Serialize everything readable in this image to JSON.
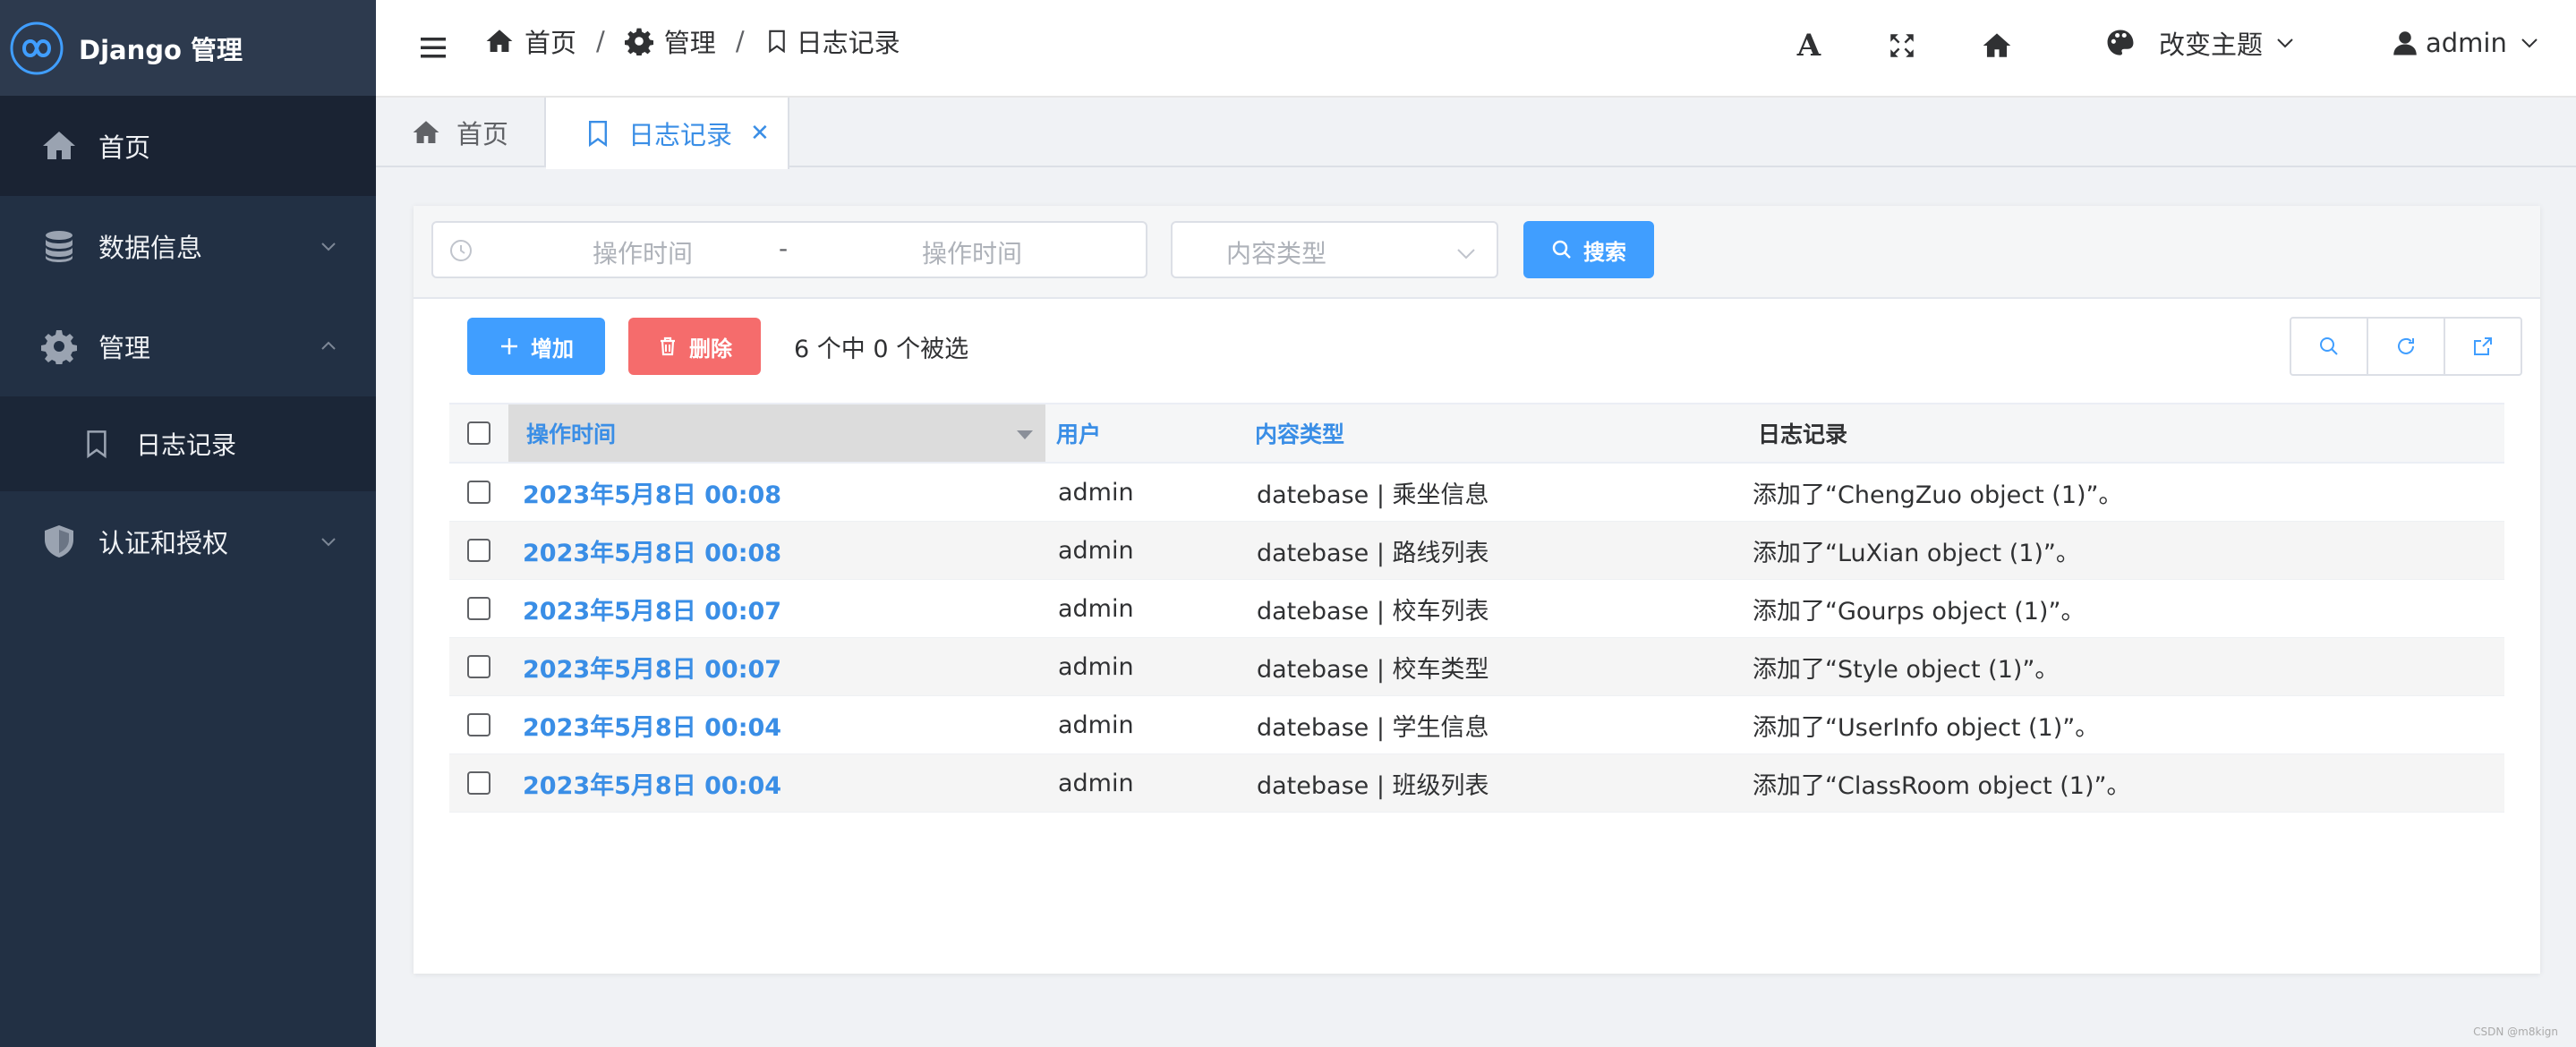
{
  "brand": {
    "title": "Django 管理"
  },
  "sidebar": {
    "items": [
      {
        "label": "首页",
        "icon": "home-icon"
      },
      {
        "label": "数据信息",
        "icon": "database-icon"
      },
      {
        "label": "管理",
        "icon": "gear-icon"
      },
      {
        "label": "日志记录",
        "icon": "bookmark-icon"
      },
      {
        "label": "认证和授权",
        "icon": "shield-icon"
      }
    ]
  },
  "header": {
    "breadcrumb": [
      "首页",
      "管理",
      "日志记录"
    ],
    "separator": "/",
    "theme_label": "改变主题",
    "user_label": "admin",
    "font_icon_glyph": "A"
  },
  "tabs": [
    {
      "label": "首页",
      "icon": "home-icon"
    },
    {
      "label": "日志记录",
      "icon": "bookmark-icon",
      "close": "✕"
    }
  ],
  "filter": {
    "date_start_placeholder": "操作时间",
    "date_sep": "-",
    "date_end_placeholder": "操作时间",
    "content_type_placeholder": "内容类型",
    "search_label": "搜索"
  },
  "actions": {
    "add_label": "增加",
    "delete_label": "删除",
    "selection_text": "6 个中 0 个被选"
  },
  "table": {
    "headers": [
      "操作时间",
      "用户",
      "内容类型",
      "日志记录"
    ],
    "rows": [
      {
        "time": "2023年5月8日 00:08",
        "user": "admin",
        "type": "datebase | 乘坐信息",
        "log": "添加了“ChengZuo object (1)”。"
      },
      {
        "time": "2023年5月8日 00:08",
        "user": "admin",
        "type": "datebase | 路线列表",
        "log": "添加了“LuXian object (1)”。"
      },
      {
        "time": "2023年5月8日 00:07",
        "user": "admin",
        "type": "datebase | 校车列表",
        "log": "添加了“Gourps object (1)”。"
      },
      {
        "time": "2023年5月8日 00:07",
        "user": "admin",
        "type": "datebase | 校车类型",
        "log": "添加了“Style object (1)”。"
      },
      {
        "time": "2023年5月8日 00:04",
        "user": "admin",
        "type": "datebase | 学生信息",
        "log": "添加了“UserInfo object (1)”。"
      },
      {
        "time": "2023年5月8日 00:04",
        "user": "admin",
        "type": "datebase | 班级列表",
        "log": "添加了“ClassRoom object (1)”。"
      }
    ]
  },
  "watermark": "CSDN @m8kign",
  "colors": {
    "sidebar": "#223044",
    "primary": "#409eff",
    "danger": "#f56c6c",
    "link": "#3a8ee6"
  }
}
